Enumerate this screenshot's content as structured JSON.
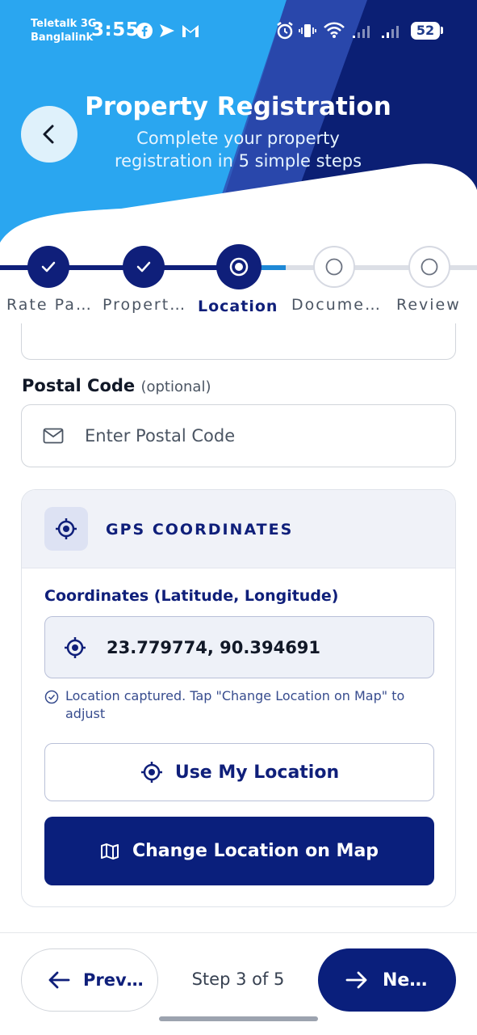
{
  "status_bar": {
    "carrier_1": "Teletalk 3G",
    "carrier_2": "Banglalink",
    "time": "3:55",
    "battery": "52"
  },
  "header": {
    "title": "Property Registration",
    "subtitle": "Complete your property registration in 5 simple steps"
  },
  "stepper": {
    "steps": [
      {
        "label": "Rate Pa…",
        "state": "done"
      },
      {
        "label": "Propert…",
        "state": "done"
      },
      {
        "label": "Location",
        "state": "active"
      },
      {
        "label": "Docume…",
        "state": "pending"
      },
      {
        "label": "Review",
        "state": "pending"
      }
    ]
  },
  "form": {
    "postal_code": {
      "label": "Postal Code",
      "optional": "(optional)",
      "placeholder": "Enter Postal Code",
      "value": ""
    },
    "gps": {
      "title": "GPS COORDINATES",
      "coords_label": "Coordinates (Latitude, Longitude)",
      "coords_value": "23.779774, 90.394691",
      "hint": "Location captured. Tap \"Change Location on Map\" to adjust",
      "use_location_label": "Use My Location",
      "change_location_label": "Change Location on Map"
    }
  },
  "footer": {
    "prev_label": "Prev…",
    "step_text": "Step 3 of 5",
    "next_label": "Ne…"
  },
  "colors": {
    "primary": "#0a1f7c",
    "header_light": "#29a3ee",
    "header_dark": "#0b1f74",
    "progress_blue": "#1e88d6",
    "pending_track": "#dcdfe6"
  }
}
